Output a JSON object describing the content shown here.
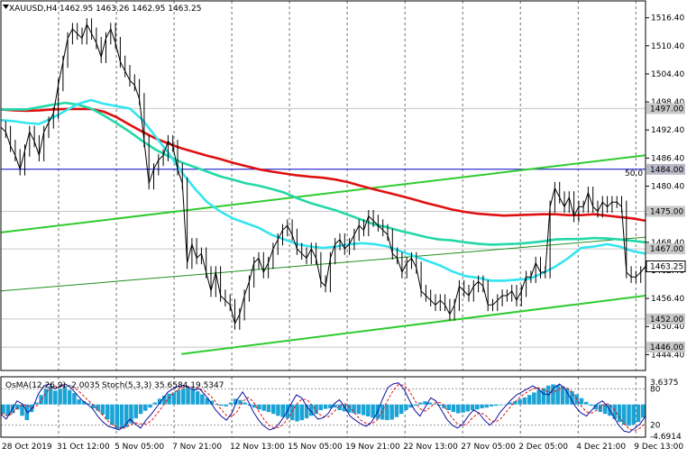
{
  "header": {
    "symbol": "XAUUSD,H4",
    "ohlc": "1462.95 1463.26 1462.95 1463.25"
  },
  "osc_header": {
    "osma": "OsMA(12,26,9) -2.0035",
    "stoch": "Stoch(5,3,3) 35.6584 19.5347"
  },
  "colors": {
    "price_line": "#000000",
    "ema_fast": "#33e5f0",
    "ema_mid": "#22d8a8",
    "ema_slow": "#e01010",
    "channel": "#2ecc2e",
    "hline": "#c8c8c8",
    "fib_line": "#0000c8",
    "osma_bar": "#1aa3d4",
    "stoch_main": "#1010a0",
    "stoch_signal": "#e01010",
    "label_bg": "#c8c8c8"
  },
  "chart_data": {
    "type": "line",
    "title": "XAUUSD,H4",
    "ylim": [
      1441,
      1520
    ],
    "y_ticks": [
      "1516.40",
      "1510.40",
      "1504.40",
      "1498.40",
      "1492.40",
      "1486.40",
      "1480.40",
      "1474.40",
      "1468.40",
      "1462.40",
      "1456.40",
      "1450.40",
      "1444.40"
    ],
    "x_labels": [
      "28 Oct 2019",
      "31 Oct 12:00",
      "5 Nov 05:00",
      "7 Nov 21:00",
      "12 Nov 13:00",
      "15 Nov 05:00",
      "19 Nov 21:00",
      "22 Nov 13:00",
      "27 Nov 05:00",
      "2 Dec 05:00",
      "4 Dec 21:00",
      "9 Dec 13:00"
    ],
    "close_price": "1463.25",
    "close_value": 1463.25,
    "levels": [
      {
        "label": "1497.00",
        "value": 1497.0,
        "style": "gray"
      },
      {
        "label": "1484.00",
        "value": 1484.0,
        "style": "blue"
      },
      {
        "label": "1475.00",
        "value": 1475.0,
        "style": "gray"
      },
      {
        "label": "1467.00",
        "value": 1467.0,
        "style": "gray"
      },
      {
        "label": "1452.00",
        "value": 1452.0,
        "style": "gray"
      },
      {
        "label": "1446.00",
        "value": 1446.0,
        "style": "gray"
      }
    ],
    "fib_label": "50.0",
    "series": [
      {
        "values": [
          1493,
          1492,
          1489,
          1487,
          1484,
          1488,
          1492,
          1490,
          1487,
          1492,
          1494,
          1496,
          1502,
          1507,
          1512,
          1514,
          1513,
          1512,
          1515,
          1513,
          1511,
          1508,
          1512,
          1514,
          1511,
          1507,
          1505,
          1503,
          1502,
          1499,
          1490,
          1481,
          1484,
          1486,
          1487,
          1490,
          1489,
          1484,
          1481,
          1464,
          1468,
          1465,
          1466,
          1462,
          1458,
          1462,
          1457,
          1456,
          1455,
          1451,
          1453,
          1457,
          1460,
          1464,
          1465,
          1462,
          1464,
          1467,
          1469,
          1471,
          1472,
          1470,
          1467,
          1466,
          1465,
          1467,
          1465,
          1460,
          1459,
          1465,
          1468,
          1469,
          1467,
          1468,
          1470,
          1472,
          1471,
          1474,
          1473,
          1472,
          1471,
          1470,
          1466,
          1465,
          1462,
          1464,
          1465,
          1463,
          1458,
          1457,
          1456,
          1455,
          1456,
          1455,
          1453,
          1455,
          1459,
          1458,
          1457,
          1459,
          1460,
          1459,
          1455,
          1455,
          1456,
          1457,
          1457,
          1458,
          1456,
          1458,
          1461,
          1461,
          1464,
          1462,
          1462,
          1476,
          1480,
          1478,
          1476,
          1478,
          1474,
          1476,
          1476,
          1479,
          1476,
          1475,
          1477,
          1476,
          1477,
          1477,
          1476,
          1462,
          1461,
          1461,
          1462,
          1463.25
        ]
      },
      {
        "name": "",
        "values": [
          1494.5,
          1494.3,
          1493.9,
          1493.7,
          1495,
          1496.5,
          1498,
          1498.8,
          1498,
          1497.5,
          1497,
          1494.5,
          1491,
          1487.5,
          1483.5,
          1480,
          1477,
          1475,
          1473.5,
          1472.5,
          1471.5,
          1470,
          1469,
          1468,
          1467.5,
          1467.2,
          1467.5,
          1468,
          1468.2,
          1468,
          1467.5,
          1466.5,
          1465.5,
          1464.5,
          1463.5,
          1462.2,
          1461.2,
          1460.8,
          1460.2,
          1460.2,
          1460.4,
          1460.6,
          1461.8,
          1463.2,
          1465,
          1467.2,
          1467.5,
          1468,
          1467.5,
          1466.5,
          1466
        ]
      },
      {
        "name": "",
        "values": [
          1496.8,
          1496.8,
          1496.8,
          1497.3,
          1497.8,
          1498.2,
          1497.8,
          1497,
          1495.5,
          1493.8,
          1492,
          1490,
          1488.2,
          1486.8,
          1485.5,
          1484.5,
          1483.5,
          1482.5,
          1481.8,
          1481,
          1480.5,
          1479.8,
          1479,
          1477.8,
          1476.8,
          1476,
          1475.2,
          1474.2,
          1473.2,
          1472.2,
          1471.6,
          1470.8,
          1470.2,
          1469.5,
          1469,
          1468.8,
          1468.4,
          1468.1,
          1467.9,
          1468,
          1468.1,
          1468.3,
          1468.6,
          1469,
          1469.1,
          1469.1,
          1469.3,
          1469.2,
          1469,
          1468.7,
          1468.4
        ]
      },
      {
        "name": "",
        "values": [
          1496.8,
          1496.6,
          1496.5,
          1496.6,
          1496.8,
          1496.9,
          1496.9,
          1496.9,
          1496.3,
          1495.1,
          1493.5,
          1492,
          1490.6,
          1489.5,
          1488.5,
          1487.7,
          1486.9,
          1486.2,
          1485.4,
          1484.7,
          1484,
          1483.5,
          1483.1,
          1482.7,
          1482.4,
          1482.2,
          1481.8,
          1481.2,
          1480.4,
          1479.7,
          1479,
          1478.3,
          1477.6,
          1476.8,
          1476.1,
          1475.4,
          1474.9,
          1474.5,
          1474.3,
          1474.1,
          1474.2,
          1474.3,
          1474.4,
          1474.4,
          1474.2,
          1474.2,
          1474.4,
          1474.1,
          1473.8,
          1473.5,
          1473
        ]
      }
    ],
    "trendlines": [
      {
        "from": [
          0,
          1470.5
        ],
        "to": [
          1,
          1487
        ]
      },
      {
        "from": [
          0,
          1458
        ],
        "to": [
          1,
          1469.5
        ]
      },
      {
        "from": [
          0.28,
          1444.5
        ],
        "to": [
          1,
          1457
        ]
      }
    ],
    "osc": {
      "ylim": [
        -5.2,
        4.4
      ],
      "labels": [
        "3.6375",
        "80",
        "20",
        "-4.6914"
      ],
      "osma": [
        -1.5,
        -1.8,
        -1.4,
        -0.8,
        -1.8,
        -2.5,
        -1.2,
        0.3,
        1.5,
        2.5,
        2.9,
        2.2,
        2.5,
        2.9,
        2.3,
        1.8,
        0.8,
        0.5,
        0.2,
        -0.6,
        -1,
        -1.6,
        -2.4,
        -3.2,
        -3.9,
        -3.8,
        -3.6,
        -3,
        -2.2,
        -1.5,
        -1,
        -0.5,
        0.3,
        0.9,
        1.4,
        1.7,
        1.9,
        2.3,
        2.6,
        2.8,
        2.6,
        2.1,
        1.6,
        1,
        0.6,
        0.1,
        -0.2,
        -0.3,
        0.3,
        0.9,
        0.7,
        0.3,
        -0.2,
        -0.5,
        -0.8,
        -1,
        -1.2,
        -1.5,
        -1.8,
        -2,
        -2.2,
        -2.5,
        -2.7,
        -2.5,
        -2.2,
        -1.8,
        -1.5,
        -0.9,
        -0.7,
        -0.6,
        -0.5,
        -0.9,
        -1.1,
        -1.3,
        -1.4,
        -1.5,
        -1.7,
        -1.9,
        -2.1,
        -2.3,
        -2.4,
        -2.5,
        -2.4,
        -2,
        -1.5,
        -0.9,
        -0.5,
        -0.2,
        0.3,
        0.5,
        0.3,
        0.1,
        -0.2,
        -0.6,
        -0.9,
        -1.2,
        -1.4,
        -1.3,
        -1.1,
        -0.9,
        -0.8,
        -0.6,
        -0.5,
        -0.3,
        -0.2,
        -0.1,
        0,
        0.3,
        0.5,
        0.8,
        1.1,
        1.5,
        1.9,
        2.3,
        2.6,
        3,
        3.2,
        3.1,
        2.9,
        2.6,
        2.1,
        1.6,
        1,
        0.4,
        -0.2,
        -0.8,
        -1.2,
        -1.5,
        -1.8,
        -2.3,
        -2.8,
        -3.2,
        -3.4,
        -3.2,
        -2.8,
        -2.1
      ],
      "stoch_main": [
        38,
        30,
        45,
        60,
        55,
        40,
        50,
        72,
        85,
        88,
        80,
        84,
        88,
        82,
        72,
        62,
        55,
        48,
        35,
        25,
        18,
        15,
        12,
        18,
        30,
        22,
        15,
        28,
        38,
        50,
        62,
        74,
        80,
        84,
        86,
        82,
        78,
        80,
        70,
        58,
        45,
        35,
        28,
        40,
        62,
        75,
        60,
        42,
        28,
        18,
        12,
        15,
        25,
        38,
        55,
        70,
        65,
        50,
        40,
        30,
        32,
        40,
        55,
        62,
        50,
        35,
        28,
        22,
        18,
        25,
        40,
        62,
        82,
        88,
        90,
        80,
        62,
        45,
        35,
        50,
        65,
        60,
        45,
        30,
        20,
        15,
        22,
        35,
        45,
        40,
        28,
        20,
        28,
        42,
        52,
        62,
        70,
        75,
        80,
        85,
        80,
        72,
        70,
        82,
        88,
        80,
        65,
        50,
        40,
        35,
        45,
        55,
        60,
        50,
        35,
        20,
        10,
        8,
        15,
        22,
        35
      ],
      "stoch_signal": [
        40,
        36,
        38,
        48,
        54,
        52,
        48,
        54,
        68,
        80,
        84,
        84,
        85,
        84,
        80,
        72,
        63,
        55,
        46,
        36,
        26,
        19,
        15,
        15,
        20,
        24,
        22,
        22,
        27,
        38,
        50,
        62,
        72,
        79,
        83,
        84,
        82,
        80,
        76,
        69,
        58,
        46,
        36,
        34,
        43,
        59,
        66,
        59,
        43,
        29,
        19,
        15,
        17,
        26,
        39,
        54,
        63,
        62,
        52,
        40,
        34,
        34,
        42,
        52,
        56,
        49,
        38,
        28,
        23,
        22,
        28,
        42,
        61,
        77,
        87,
        86,
        77,
        62,
        47,
        43,
        50,
        58,
        57,
        45,
        32,
        22,
        19,
        24,
        34,
        40,
        38,
        29,
        25,
        30,
        41,
        52,
        61,
        69,
        75,
        80,
        82,
        79,
        74,
        75,
        80,
        83,
        78,
        65,
        52,
        42,
        40,
        45,
        53,
        55,
        48,
        35,
        22,
        13,
        11,
        15,
        24
      ]
    }
  }
}
